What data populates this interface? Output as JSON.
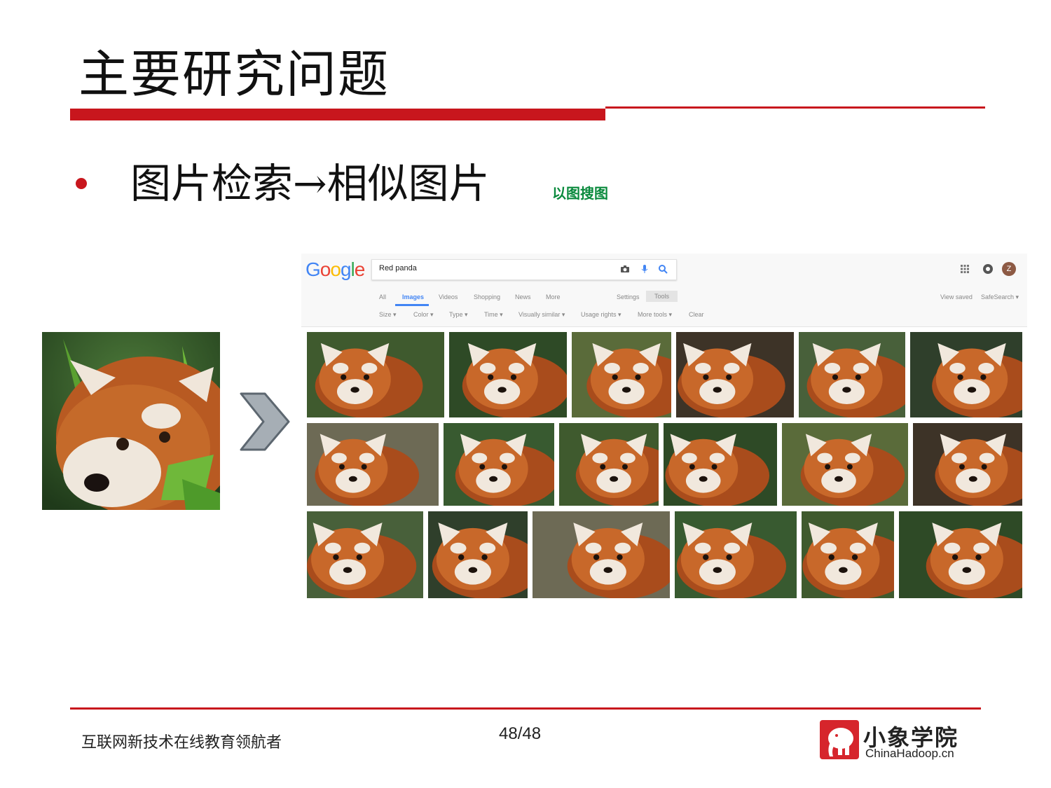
{
  "slide": {
    "title": "主要研究问题",
    "bullet": "图片检索→相似图片",
    "bullet_note": "以图搜图",
    "footer_left": "互联网新技术在线教育领航者",
    "page_number": "48/48",
    "logo_text": "小象学院",
    "logo_subtext": "ChinaHadoop.cn"
  },
  "google": {
    "logo": "Google",
    "search_value": "Red panda",
    "tabs": [
      "All",
      "Images",
      "Videos",
      "Shopping",
      "News",
      "More"
    ],
    "active_tab": "Images",
    "settings": "Settings",
    "tools": "Tools",
    "view_saved": "View saved",
    "safesearch": "SafeSearch ▾",
    "filters": [
      "Size ▾",
      "Color ▾",
      "Type ▾",
      "Time ▾",
      "Visually similar ▾",
      "Usage rights ▾",
      "More tools ▾",
      "Clear"
    ],
    "avatar_letter": "Z"
  },
  "colors": {
    "accent_red": "#c8161d",
    "note_green": "#0a8a3d",
    "google_blue": "#4285f4"
  }
}
